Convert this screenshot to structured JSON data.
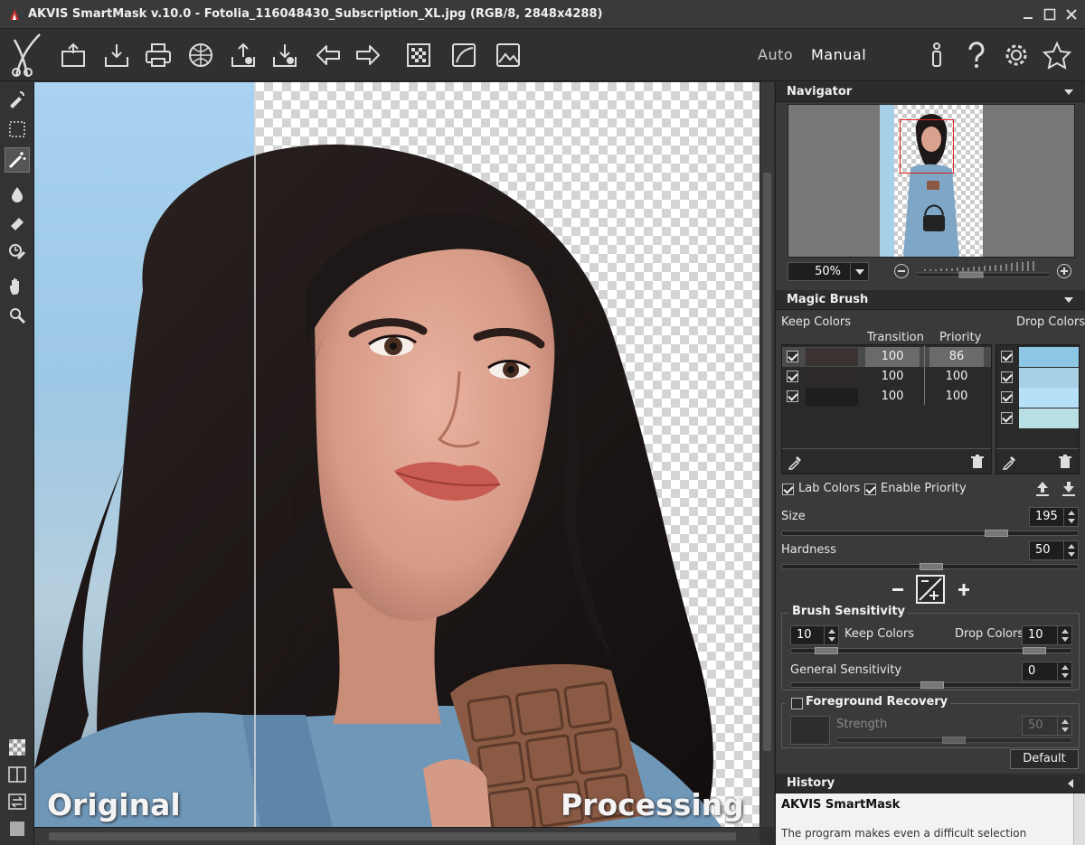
{
  "window": {
    "title": "AKVIS SmartMask v.10.0 - Fotolia_116048430_Subscription_XL.jpg (RGB/8, 2848x4288)"
  },
  "toolbar": {
    "buttons": [
      "open-icon",
      "save-icon",
      "print-icon",
      "share-icon",
      "import-icon",
      "export-icon",
      "back-icon",
      "forward-icon",
      "run-icon",
      "preferences-icon",
      "background-icon"
    ],
    "mode_auto": "Auto",
    "mode_manual": "Manual"
  },
  "canvas": {
    "label_left": "Original",
    "label_right": "Processing"
  },
  "navigator": {
    "title": "Navigator",
    "zoom": "50%"
  },
  "magic_brush": {
    "title": "Magic Brush",
    "keep_colors_label": "Keep Colors",
    "drop_colors_label": "Drop Colors",
    "col_transition": "Transition",
    "col_priority": "Priority",
    "keep_rows": [
      {
        "color": "#3a3331",
        "transition": "100",
        "priority": "86",
        "checked": true,
        "selected": true
      },
      {
        "color": "#2e2a29",
        "transition": "100",
        "priority": "100",
        "checked": true,
        "selected": false
      },
      {
        "color": "#1f1d1d",
        "transition": "100",
        "priority": "100",
        "checked": true,
        "selected": false
      }
    ],
    "drop_rows": [
      {
        "color": "#8ec6e6",
        "checked": true
      },
      {
        "color": "#a7d0e5",
        "checked": true
      },
      {
        "color": "#b5e0f7",
        "checked": true
      },
      {
        "color": "#b8dfe4",
        "checked": true
      }
    ],
    "lab_colors": "Lab Colors",
    "enable_priority": "Enable Priority",
    "size_label": "Size",
    "size_value": "195",
    "hardness_label": "Hardness",
    "hardness_value": "50",
    "brush_sensitivity": {
      "title": "Brush Sensitivity",
      "keep_value": "10",
      "keep_label": "Keep Colors",
      "drop_label": "Drop Colors",
      "drop_value": "10",
      "general_label": "General Sensitivity",
      "general_value": "0"
    },
    "foreground_recovery": {
      "title": "Foreground Recovery",
      "strength_label": "Strength",
      "strength_value": "50"
    },
    "default_button": "Default"
  },
  "history": {
    "title": "History",
    "item_title": "AKVIS SmartMask",
    "item_text": "The program makes even a difficult selection"
  }
}
